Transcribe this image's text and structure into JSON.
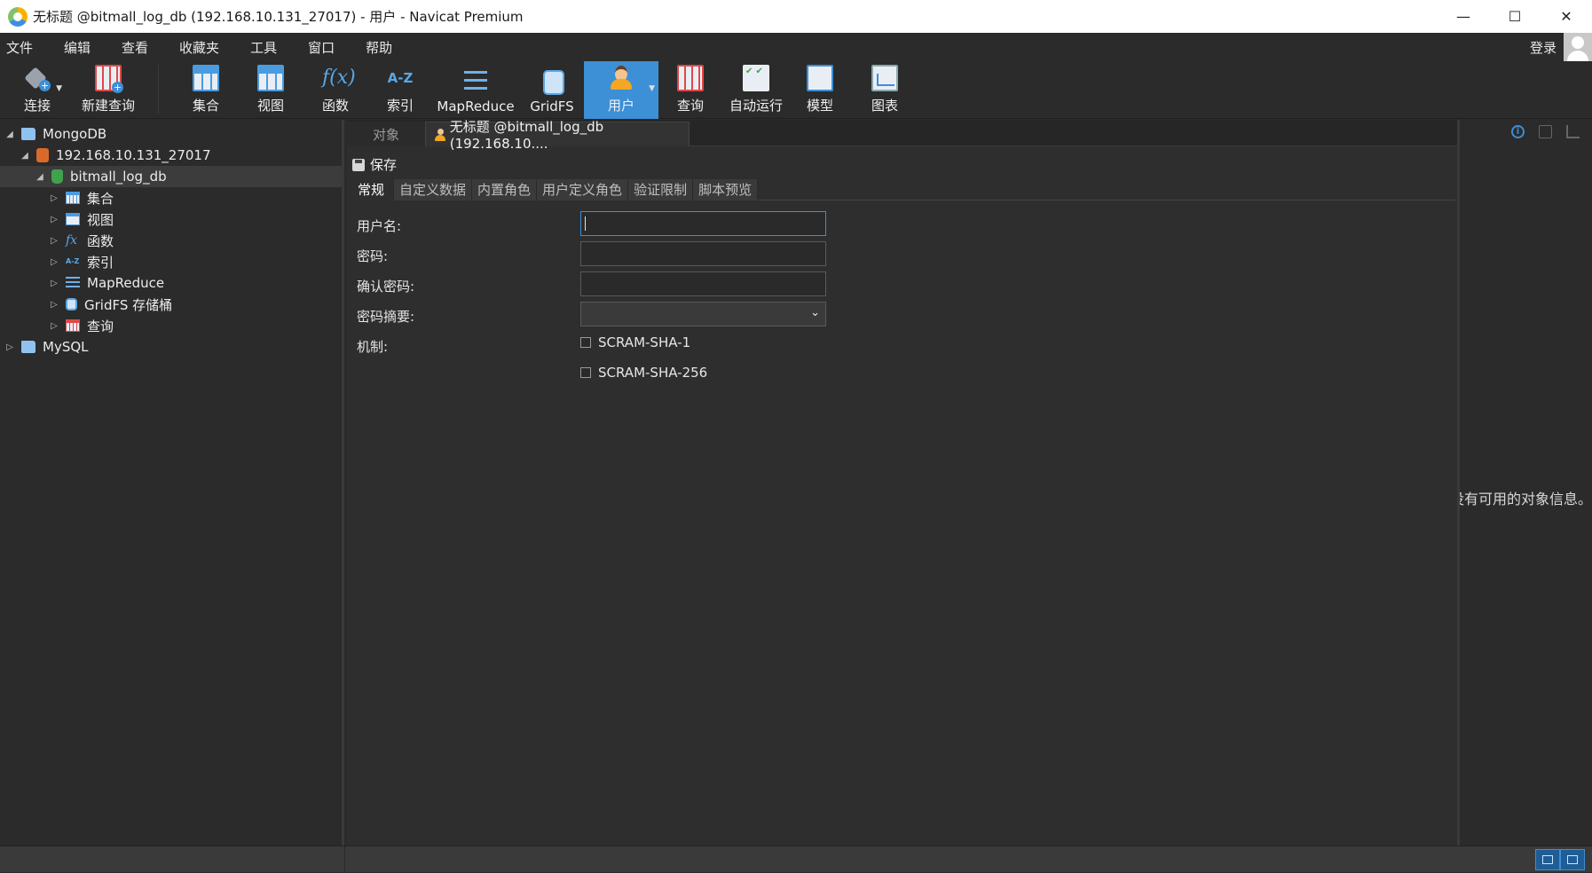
{
  "window": {
    "title": "无标题 @bitmall_log_db (192.168.10.131_27017) - 用户 - Navicat Premium",
    "controls": {
      "minimize": "—",
      "maximize": "☐",
      "close": "✕"
    }
  },
  "menu": {
    "items": [
      "文件",
      "编辑",
      "查看",
      "收藏夹",
      "工具",
      "窗口",
      "帮助"
    ],
    "login": "登录"
  },
  "toolbar": {
    "connect": "连接",
    "new_query": "新建查询",
    "collection": "集合",
    "view": "视图",
    "function": "函数",
    "function_glyph": "f(x)",
    "index": "索引",
    "index_glyph": "A-Z",
    "mapreduce": "MapReduce",
    "gridfs": "GridFS",
    "user": "用户",
    "query": "查询",
    "automation": "自动运行",
    "model": "模型",
    "chart": "图表"
  },
  "tree": {
    "root": "MongoDB",
    "server": "192.168.10.131_27017",
    "database": "bitmall_log_db",
    "children": [
      "集合",
      "视图",
      "函数",
      "索引",
      "MapReduce",
      "GridFS 存储桶",
      "查询"
    ],
    "mysql": "MySQL",
    "fx_glyph": "fx",
    "az_glyph": "A-Z"
  },
  "tabs": {
    "objects": "对象",
    "active": "无标题 @bitmall_log_db (192.168.10...."
  },
  "editor": {
    "save": "保存",
    "subtabs": [
      "常规",
      "自定义数据",
      "内置角色",
      "用户定义角色",
      "验证限制",
      "脚本预览"
    ],
    "fields": {
      "username_label": "用户名:",
      "username_value": "",
      "password_label": "密码:",
      "password_value": "",
      "confirm_label": "确认密码:",
      "confirm_value": "",
      "digest_label": "密码摘要:",
      "digest_value": "",
      "mechanism_label": "机制:"
    },
    "mechanisms": [
      "SCRAM-SHA-1",
      "SCRAM-SHA-256"
    ]
  },
  "info_panel": {
    "message": "没有可用的对象信息。"
  },
  "colors": {
    "accent": "#3d8fd6",
    "background": "#2b2b2b"
  }
}
